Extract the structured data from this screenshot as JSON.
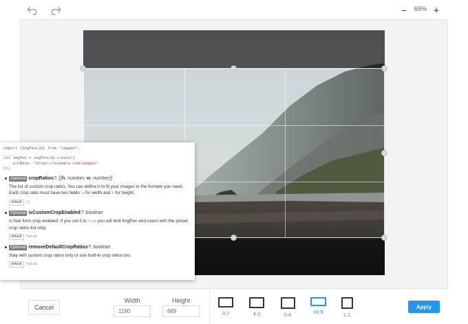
{
  "toolbar": {
    "undo_icon": "undo-arrow-icon",
    "redo_icon": "redo-arrow-icon",
    "zoom_out_symbol": "−",
    "zoom_level": "65%",
    "zoom_in_symbol": "+"
  },
  "docs": {
    "code_line1_a": "import {ImgPenLib} from ",
    "code_line1_str": "\"imgpen\"",
    "code_line1_b": ";",
    "code_line2": "let imgPen = imgPenLib.create({",
    "code_line3_a": "    urlBase: ",
    "code_line3_str": "\"https://example.com/imgpen\"",
    "code_line4": "});",
    "props": [
      {
        "badge": "Optional",
        "name": "cropRatios",
        "type_prefix": "?: [{",
        "type_h_key": "h",
        "type_h_type": ": number; ",
        "type_w_key": "w",
        "type_w_type": ": number",
        "type_suffix": "}]",
        "desc_a": "The list of custom crop ratios. You can define it to fit your images to the formats you need. Each crop ratio must have two fields: ",
        "desc_code1": "w",
        "desc_b": " for width and ",
        "desc_code2": "h",
        "desc_c": " for height.",
        "default_label": "default",
        "default_value": "[]"
      },
      {
        "badge": "Optional",
        "name": "isCustomCropEnabled",
        "type": "?: boolean",
        "desc_a": "Is free form crop enabled. If you set it to ",
        "desc_code1": "true",
        "desc_b": " you will limit ImgPen end-users with the preset crop ratios list only.",
        "default_label": "default",
        "default_value": "false"
      },
      {
        "badge": "Optional",
        "name": "removeDefaultCropRatios",
        "type": "?: boolean",
        "desc_a": "Stay with custom crop ratios only or use built-in crop ratios too.",
        "default_label": "default",
        "default_value": "false"
      }
    ]
  },
  "bottom": {
    "cancel_label": "Cancel",
    "width_label": "Width",
    "width_value": "1190",
    "height_label": "Height",
    "height_value": "669",
    "ratios": [
      {
        "label": "3:2"
      },
      {
        "label": "4:3"
      },
      {
        "label": "5:4"
      },
      {
        "label": "16:9"
      },
      {
        "label": "1:1"
      }
    ],
    "active_ratio": "16:9",
    "apply_label": "Apply"
  },
  "colors": {
    "accent": "#2196f3",
    "overlay": "#000000"
  }
}
